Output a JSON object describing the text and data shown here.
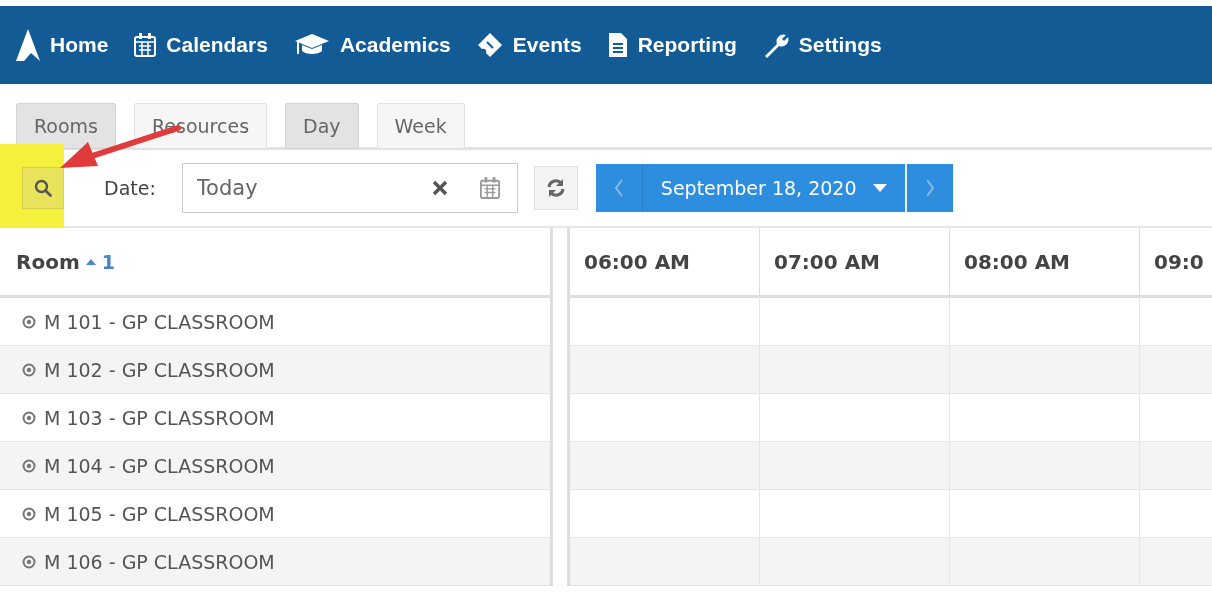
{
  "nav": {
    "items": [
      {
        "label": "Home",
        "kind": "logo"
      },
      {
        "label": "Calendars",
        "kind": "calendar"
      },
      {
        "label": "Academics",
        "kind": "cap"
      },
      {
        "label": "Events",
        "kind": "ticket"
      },
      {
        "label": "Reporting",
        "kind": "document"
      },
      {
        "label": "Settings",
        "kind": "wrench"
      }
    ]
  },
  "toolbar": {
    "groups": [
      [
        {
          "label": "Rooms",
          "selected": true
        },
        {
          "label": "Resources",
          "selected": false
        }
      ],
      [
        {
          "label": "Day",
          "selected": true
        },
        {
          "label": "Week",
          "selected": false
        }
      ]
    ]
  },
  "filter": {
    "date_label": "Date:",
    "date_field": {
      "value": "Today"
    },
    "date_nav": {
      "label": "September 18, 2020"
    }
  },
  "grid": {
    "room_header": {
      "label": "Room",
      "sort_order": "1"
    },
    "time_columns": [
      "06:00 AM",
      "07:00 AM",
      "08:00 AM",
      "09:0"
    ],
    "rows": [
      "M 101 - GP CLASSROOM",
      "M 102 - GP CLASSROOM",
      "M 103 - GP CLASSROOM",
      "M 104 - GP CLASSROOM",
      "M 105 - GP CLASSROOM",
      "M 106 - GP CLASSROOM"
    ]
  }
}
